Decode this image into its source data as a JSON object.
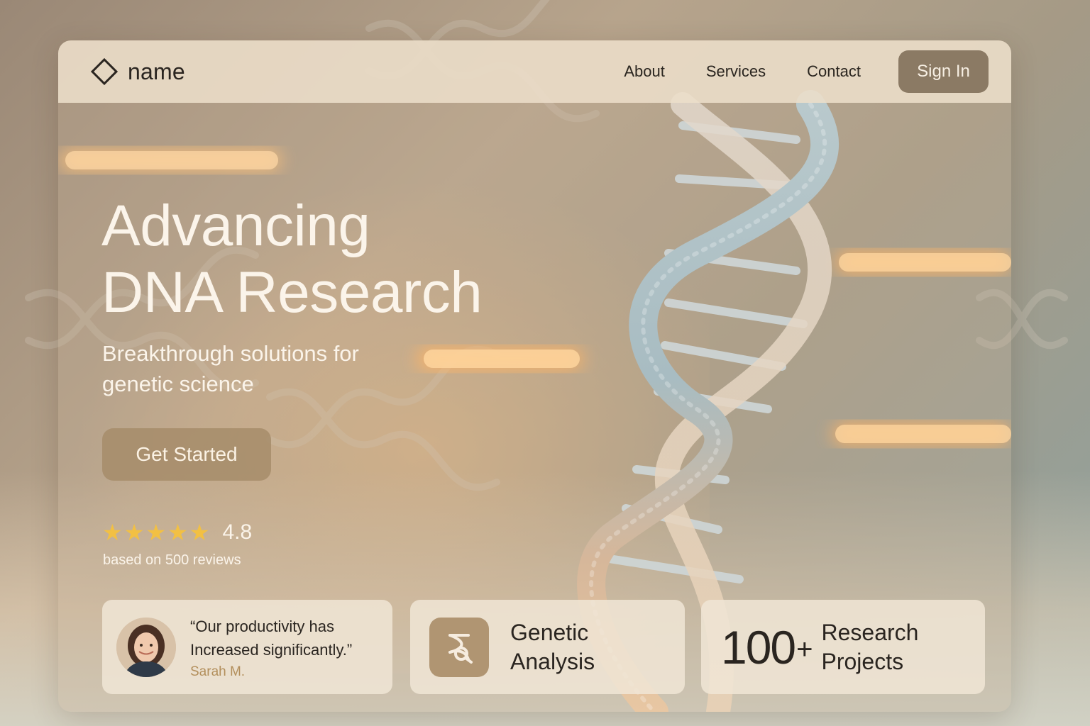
{
  "navbar": {
    "brand": "name",
    "links": [
      "About",
      "Services",
      "Contact"
    ],
    "signin_label": "Sign In"
  },
  "hero": {
    "title_line1": "Advancing",
    "title_line2": "DNA Research",
    "subtitle": "Breakthrough solutions for genetic science",
    "cta_label": "Get Started",
    "rating_value": "4.8",
    "rating_stars": 5,
    "reviews_text": "based on 500 reviews"
  },
  "cards": {
    "testimonial": {
      "quote": "“Our productivity has Increased significantly.”",
      "author": "Sarah M."
    },
    "genetic": {
      "title": "Genetic Analysis",
      "icon": "dna-analysis-icon"
    },
    "projects": {
      "count": "100",
      "plus": "+",
      "label": "Research Projects"
    }
  },
  "colors": {
    "accent": "#8b7a64",
    "cta": "#a68c6a",
    "star": "#f2c043",
    "author": "#b38f5c",
    "glow": "#ffb566"
  }
}
